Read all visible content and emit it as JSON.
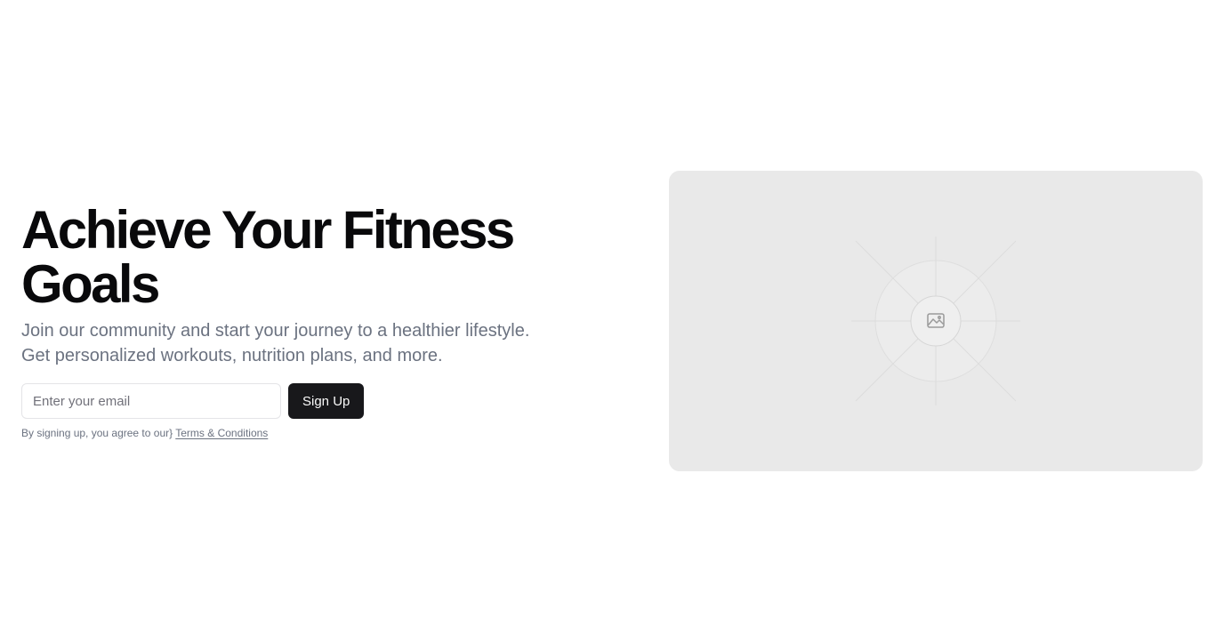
{
  "hero": {
    "headline": "Achieve Your Fitness Goals",
    "subtitle": "Join our community and start your journey to a healthier lifestyle. Get personalized workouts, nutrition plans, and more.",
    "email_placeholder": "Enter your email",
    "email_value": "",
    "signup_label": "Sign Up",
    "legal_prefix": "By signing up, you agree to our}",
    "terms_link": "Terms & Conditions"
  },
  "image_placeholder": {
    "icon": "image-icon"
  },
  "colors": {
    "background": "#ffffff",
    "headline": "#09090b",
    "muted_text": "#6b7280",
    "button_bg": "#18181b",
    "button_text": "#fafafa",
    "input_border": "#e4e4e7",
    "image_bg": "#e9e9e9"
  }
}
